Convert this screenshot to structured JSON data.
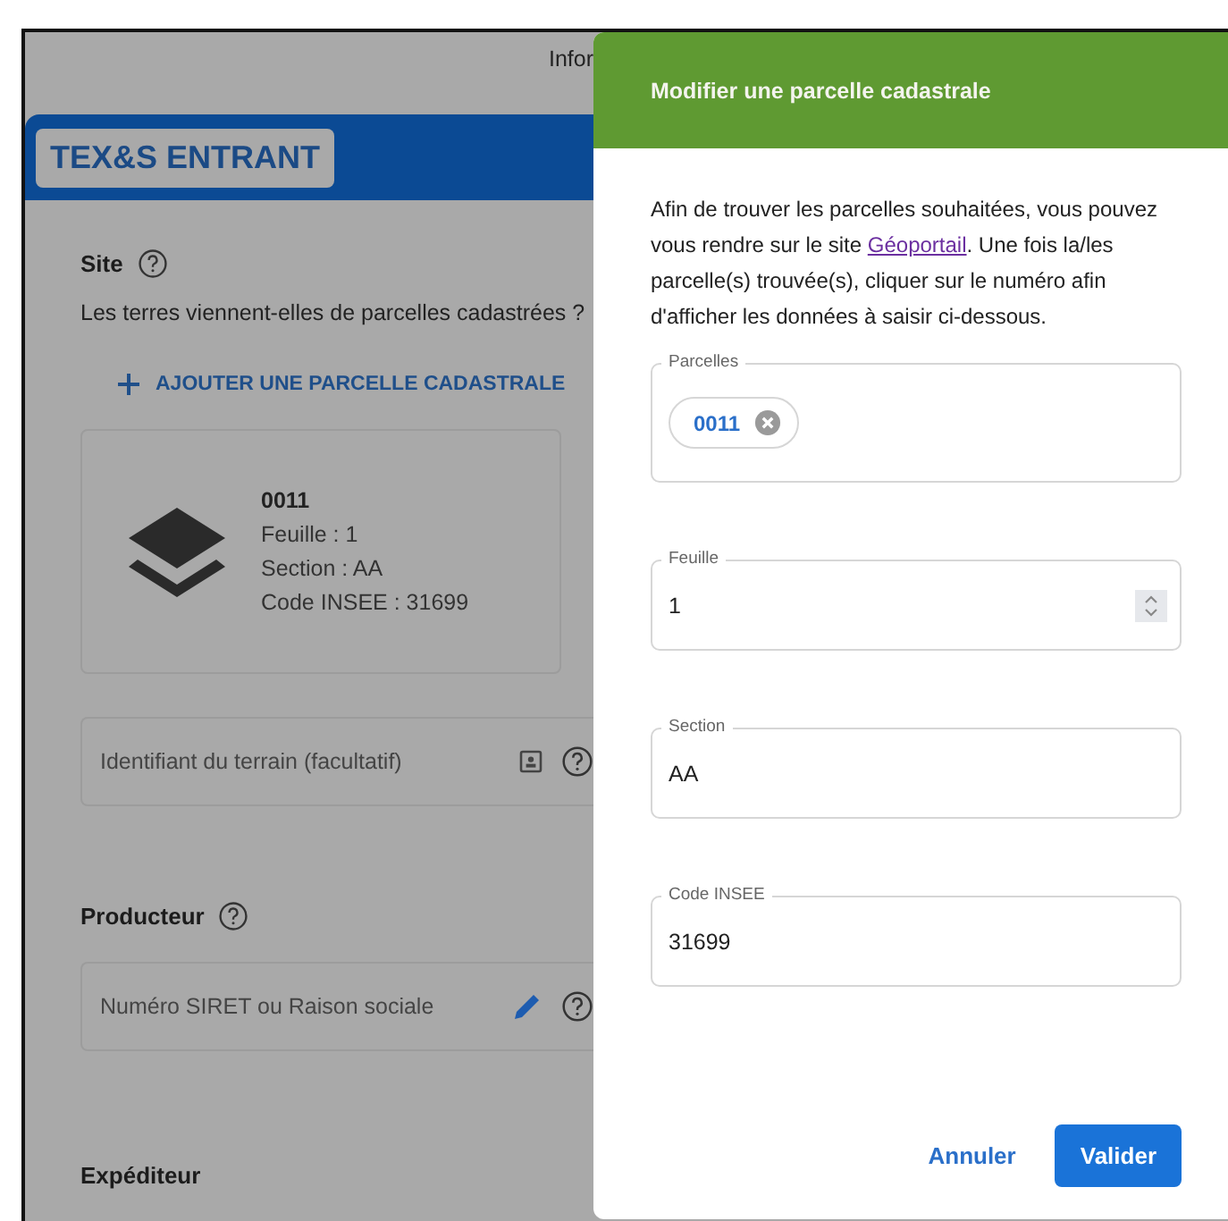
{
  "top_nav": {
    "label": "Infor"
  },
  "header": {
    "tag": "TEX&S ENTRANT"
  },
  "site": {
    "title": "Site",
    "question": "Les terres viennent-elles de parcelles cadastrées ?",
    "add_button": "AJOUTER UNE PARCELLE CADASTRALE",
    "parcel_card": {
      "number": "0011",
      "lines": [
        "Feuille : 1",
        "Section : AA",
        "Code INSEE : 31699"
      ]
    },
    "terrain_field": {
      "placeholder": "Identifiant du terrain (facultatif)"
    }
  },
  "producteur": {
    "title": "Producteur",
    "field": {
      "placeholder": "Numéro SIRET ou Raison sociale"
    }
  },
  "expediteur": {
    "title": "Expéditeur"
  },
  "dialog": {
    "title": "Modifier une parcelle cadastrale",
    "intro_start": "Afin de trouver les parcelles souhaitées, vous pouvez vous rendre sur le site ",
    "link": "Géoportail",
    "intro_end": ". Une fois la/les parcelle(s) trouvée(s), cliquer sur le numéro afin d'afficher les données à saisir ci-dessous.",
    "fields": [
      {
        "kind": "chips",
        "label": "Parcelles",
        "chips": [
          "0011"
        ]
      },
      {
        "kind": "number",
        "label": "Feuille",
        "value": "1"
      },
      {
        "kind": "text",
        "label": "Section",
        "value": "AA"
      },
      {
        "kind": "text",
        "label": "Code INSEE",
        "value": "31699"
      }
    ],
    "buttons": [
      {
        "kind": "text",
        "label": "Annuler"
      },
      {
        "kind": "primary",
        "label": "Valider"
      }
    ]
  }
}
